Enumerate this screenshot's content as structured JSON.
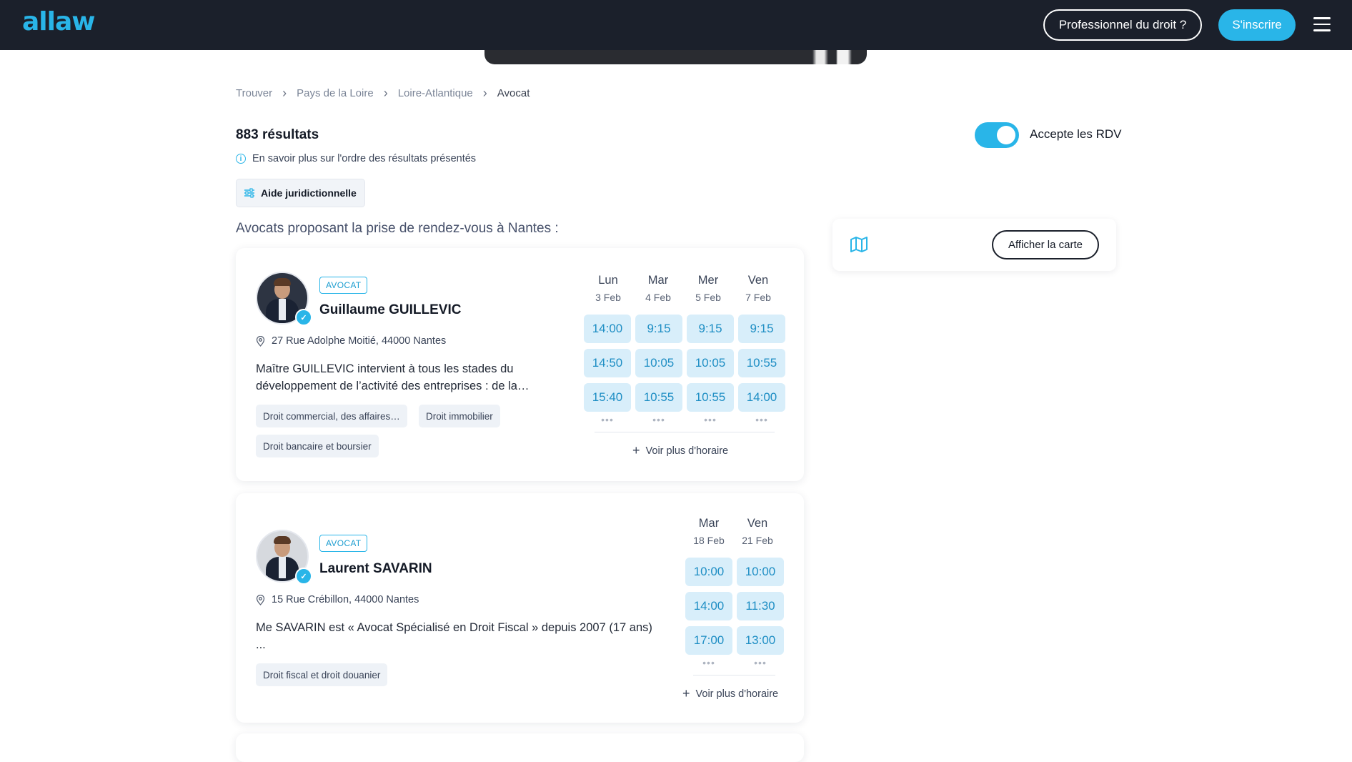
{
  "header": {
    "logo": "allaw",
    "pro_button": "Professionnel du droit ?",
    "signup_button": "S'inscrire"
  },
  "breadcrumb": {
    "items": [
      "Trouver",
      "Pays de la Loire",
      "Loire-Atlantique",
      "Avocat"
    ],
    "separator": "›"
  },
  "results": {
    "count_label": "883 résultats",
    "info_link": "En savoir plus sur l'ordre des résultats présentés",
    "toggle_label": "Accepte les RDV",
    "toggle_on": true,
    "filter_label": "Aide juridictionnelle",
    "section_title": "Avocats proposant la prise de rendez-vous à Nantes :"
  },
  "map": {
    "button_label": "Afficher la carte"
  },
  "lawyers": [
    {
      "badge": "AVOCAT",
      "name": "Guillaume GUILLEVIC",
      "address": "27 Rue Adolphe Moitié, 44000 Nantes",
      "description_line1": "Maître GUILLEVIC intervient à tous les stades du",
      "description_line2": "développement de l’activité des entreprises : de la…",
      "tags": [
        "Droit commercial, des affaires…",
        "Droit immobilier",
        "Droit bancaire et boursier"
      ],
      "days": [
        {
          "name": "Lun",
          "date": "3 Feb",
          "slots": [
            "14:00",
            "14:50",
            "15:40"
          ]
        },
        {
          "name": "Mar",
          "date": "4 Feb",
          "slots": [
            "9:15",
            "10:05",
            "10:55"
          ]
        },
        {
          "name": "Mer",
          "date": "5 Feb",
          "slots": [
            "9:15",
            "10:05",
            "10:55"
          ]
        },
        {
          "name": "Ven",
          "date": "7 Feb",
          "slots": [
            "9:15",
            "10:55",
            "14:00"
          ]
        }
      ],
      "more_label": "Voir plus d'horaire"
    },
    {
      "badge": "AVOCAT",
      "name": "Laurent SAVARIN",
      "address": "15 Rue Crébillon, 44000 Nantes",
      "description_line1": "Me SAVARIN est « Avocat Spécialisé en Droit Fiscal » depuis 2007 (17 ans)",
      "description_line2": "...",
      "tags": [
        "Droit fiscal et droit douanier"
      ],
      "days": [
        {
          "name": "Mar",
          "date": "18 Feb",
          "slots": [
            "10:00",
            "14:00",
            "17:00"
          ]
        },
        {
          "name": "Ven",
          "date": "21 Feb",
          "slots": [
            "10:00",
            "11:30",
            "13:00"
          ]
        }
      ],
      "more_label": "Voir plus d'horaire"
    }
  ],
  "colors": {
    "accent": "#29b5e8",
    "header_bg": "#1b202b",
    "slot_bg": "#d8eefa",
    "slot_text": "#1e8ec4"
  },
  "icons": [
    "hamburger-icon",
    "chevron-right-icon",
    "info-icon",
    "sliders-icon",
    "map-icon",
    "location-pin-icon",
    "verified-check-icon",
    "plus-icon"
  ]
}
